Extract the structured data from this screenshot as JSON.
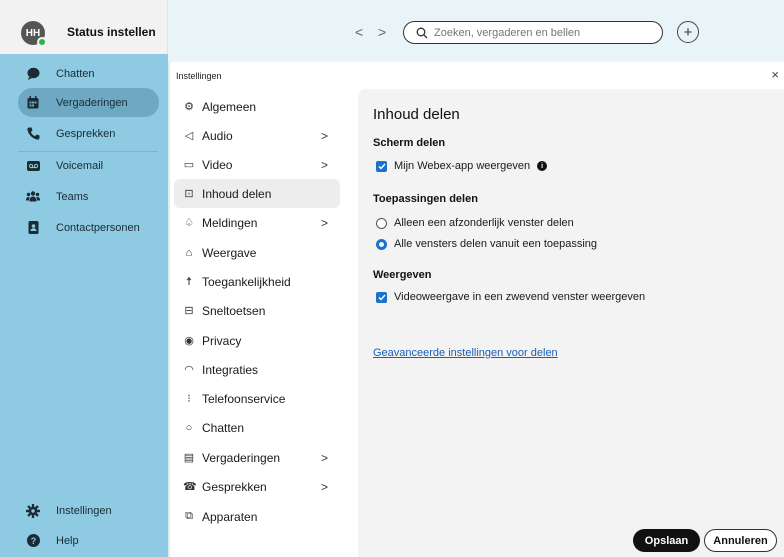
{
  "header": {
    "avatar_initials": "HH",
    "status_title": "Status instellen",
    "back_label": "<",
    "forward_label": ">",
    "search_placeholder": "Zoeken, vergaderen en bellen",
    "new_label": "+"
  },
  "sidebar": {
    "items": [
      {
        "label": "Chatten",
        "icon": "chat-icon"
      },
      {
        "label": "Vergaderingen",
        "icon": "calendar-icon",
        "active": true
      },
      {
        "label": "Gesprekken",
        "icon": "phone-icon"
      },
      {
        "label": "Voicemail",
        "icon": "voicemail-icon"
      },
      {
        "label": "Teams",
        "icon": "teams-icon"
      },
      {
        "label": "Contactpersonen",
        "icon": "contacts-icon"
      }
    ],
    "bottom": [
      {
        "label": "Instellingen",
        "icon": "gear-icon"
      },
      {
        "label": "Help",
        "icon": "help-icon"
      }
    ]
  },
  "dialog": {
    "title": "Instellingen",
    "close_label": "×",
    "nav": [
      {
        "label": "Algemeen",
        "icon": "gear-icon",
        "chevron": false
      },
      {
        "label": "Audio",
        "icon": "speaker-icon",
        "chevron": true
      },
      {
        "label": "Video",
        "icon": "video-icon",
        "chevron": true
      },
      {
        "label": "Inhoud delen",
        "icon": "share-icon",
        "chevron": false,
        "active": true
      },
      {
        "label": "Meldingen",
        "icon": "bell-icon",
        "chevron": true
      },
      {
        "label": "Weergave",
        "icon": "display-icon",
        "chevron": false
      },
      {
        "label": "Toegankelijkheid",
        "icon": "accessibility-icon",
        "chevron": false
      },
      {
        "label": "Sneltoetsen",
        "icon": "keyboard-icon",
        "chevron": false
      },
      {
        "label": "Privacy",
        "icon": "privacy-icon",
        "chevron": false
      },
      {
        "label": "Integraties",
        "icon": "cloud-icon",
        "chevron": false
      },
      {
        "label": "Telefoonservice",
        "icon": "dialpad-icon",
        "chevron": false
      },
      {
        "label": "Chatten",
        "icon": "chat-icon",
        "chevron": false
      },
      {
        "label": "Vergaderingen",
        "icon": "calendar-icon",
        "chevron": true
      },
      {
        "label": "Gesprekken",
        "icon": "call-icon",
        "chevron": true
      },
      {
        "label": "Apparaten",
        "icon": "devices-icon",
        "chevron": false
      }
    ],
    "content": {
      "title": "Inhoud delen",
      "screen_section": "Scherm delen",
      "show_app_label": "Mijn Webex-app weergeven",
      "apps_section": "Toepassingen delen",
      "radio_single": "Alleen een afzonderlijk venster delen",
      "radio_all": "Alle vensters delen vanuit een toepassing",
      "view_section": "Weergeven",
      "floating_label": "Videoweergave in een zwevend venster weergeven",
      "advanced_link": "Geavanceerde instellingen voor delen"
    },
    "save_label": "Opslaan",
    "cancel_label": "Annuleren"
  },
  "colors": {
    "sidebar_bg": "#8ecbe3",
    "sidebar_active": "#6da9c2",
    "accent": "#1a73c9",
    "status_online": "#2fb24c"
  }
}
